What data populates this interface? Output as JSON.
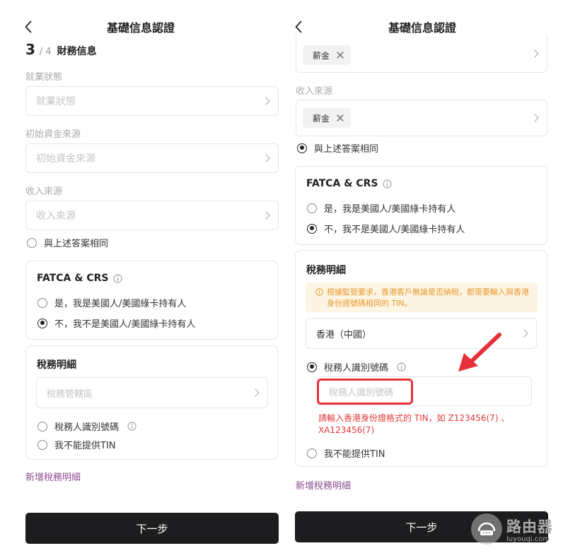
{
  "header": {
    "title": "基礎信息認證"
  },
  "step": {
    "current": "3",
    "separator": "/",
    "total": "4",
    "title": "財務信息"
  },
  "fields": {
    "employment_label": "就業狀態",
    "employment_placeholder": "就業狀態",
    "initial_funds_label": "初始資金來源",
    "initial_funds_placeholder": "初始資金來源",
    "income_label": "收入來源",
    "income_placeholder": "收入來源",
    "same_as_above": "與上述答案相同"
  },
  "fatca": {
    "title": "FATCA & CRS",
    "option_yes": "是，我是美國人/美國綠卡持有人",
    "option_no": "不，我不是美國人/美國綠卡持有人"
  },
  "tax": {
    "title": "稅務明細",
    "jurisdiction_placeholder": "稅務管轄區",
    "tin_option": "稅務人識別號碼",
    "no_tin_option": "我不能提供TIN",
    "add_link": "新增稅務明細",
    "notice": "根據監管要求，香港客戶無論是否納稅，都需要輸入與香港身份證號碼相同的 TIN。",
    "jurisdiction_value": "香港（中國）",
    "tin_placeholder": "稅務人識別號碼",
    "error": "請輸入香港身份證格式的 TIN，如 Z123456(7) 、XA123456(7)"
  },
  "right_fields": {
    "tag_top": "薪金",
    "income_label": "收入來源",
    "tag_income": "薪金"
  },
  "buttons": {
    "next": "下一步"
  },
  "watermark": {
    "title": "路由器",
    "subtitle": "luyouqi.com"
  },
  "colors": {
    "accent_link": "#8a4a8e",
    "error": "#e23a3a",
    "notice_bg": "#fdf4e3",
    "notice_text": "#e79a2e",
    "button_bg": "#1d1d1f",
    "arrow": "#e8303a"
  },
  "icons": [
    "back-icon",
    "chevron-right-icon",
    "info-icon",
    "close-icon",
    "warning-icon",
    "router-logo-icon"
  ]
}
